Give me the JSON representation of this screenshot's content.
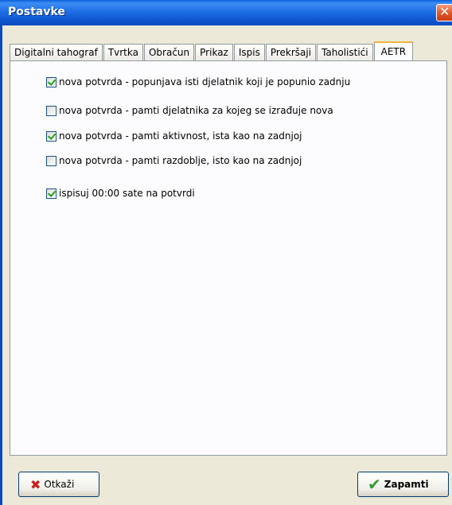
{
  "window": {
    "title": "Postavke",
    "close_glyph": "✕"
  },
  "tabs": [
    {
      "label": "Digitalni tahograf",
      "active": false
    },
    {
      "label": "Tvrtka",
      "active": false
    },
    {
      "label": "Obračun",
      "active": false
    },
    {
      "label": "Prikaz",
      "active": false
    },
    {
      "label": "Ispis",
      "active": false
    },
    {
      "label": "Prekršaji",
      "active": false
    },
    {
      "label": "Taholistići",
      "active": false
    },
    {
      "label": "AETR",
      "active": true
    }
  ],
  "options": [
    {
      "label": "nova potvrda - popunjava isti djelatnik koji je popunio zadnju",
      "checked": true
    },
    {
      "label": "nova potvrda - pamti djelatnika za kojeg se izrađuje nova",
      "checked": false
    },
    {
      "label": "nova potvrda - pamti aktivnost, ista kao na zadnjoj",
      "checked": true
    },
    {
      "label": "nova potvrda - pamti razdoblje, isto kao na zadnjoj",
      "checked": false
    },
    {
      "label": "ispisuj 00:00 sate na potvrdi",
      "checked": true
    }
  ],
  "buttons": {
    "cancel": {
      "label": "Otkaži",
      "icon": "red-x-icon",
      "color": "#cc1f1f"
    },
    "save": {
      "label": "Zapamti",
      "icon": "green-check-icon",
      "color": "#2e9a2e"
    }
  }
}
